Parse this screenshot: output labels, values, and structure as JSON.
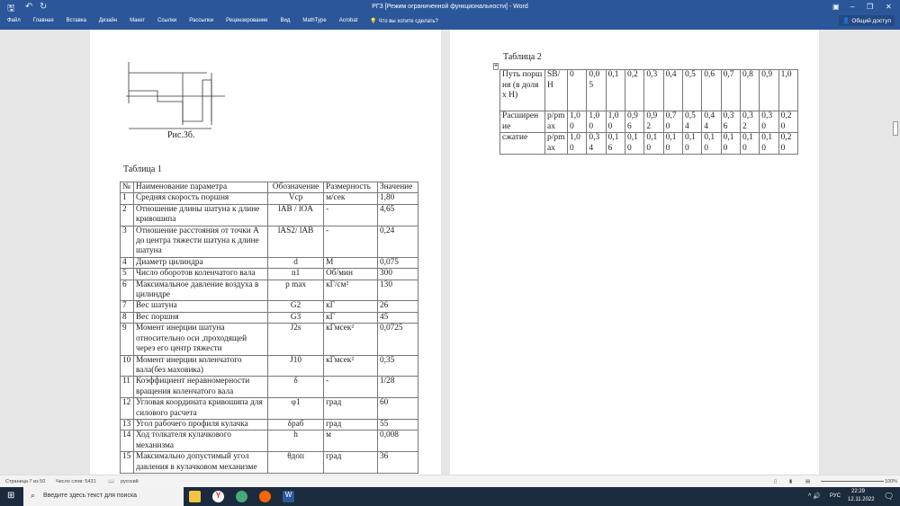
{
  "window": {
    "title": "РГЗ [Режим ограниченной функциональности] - Word",
    "share": "Общий доступ"
  },
  "ribbon": {
    "tabs": [
      "Файл",
      "Главная",
      "Вставка",
      "Дизайн",
      "Макет",
      "Ссылки",
      "Рассылки",
      "Рецензирование",
      "Вид",
      "MathType",
      "Acrobat"
    ],
    "tell_me": "Что вы хотите сделать?"
  },
  "figure": {
    "caption": "Рис.3б."
  },
  "table1": {
    "caption": "Таблица 1",
    "headers": [
      "№",
      "Наименование параметра",
      "Обозначение",
      "Размерность",
      "Значение"
    ],
    "rows": [
      [
        "1",
        "Средняя скорость поршня",
        "Vср",
        "м/сек",
        "1,80"
      ],
      [
        "2",
        "Отношение длины шатуна к длине кривошипа",
        "lAB / lOA",
        "-",
        "4,65"
      ],
      [
        "3",
        "Отношение расстояния от точки А до центра тяжести шатуна к длине шатуна",
        "lAS2/ lAB",
        "-",
        "0,24"
      ],
      [
        "4",
        "Диаметр цилиндра",
        "d",
        "М",
        "0,075"
      ],
      [
        "5",
        "Число оборотов коленчатого вала",
        "n1",
        "Об/мин",
        "300"
      ],
      [
        "6",
        "Максимальное давление воздуха в цилиндре",
        "p max",
        "кГ/см²",
        "130"
      ],
      [
        "7",
        "Вес шатуна",
        "G2",
        "кГ",
        "26"
      ],
      [
        "8",
        "Вес поршня",
        "G3",
        "кГ",
        "45"
      ],
      [
        "9",
        "Момент инерции шатуна относительно оси ,проходящей через его центр тяжести",
        "J2s",
        "кГмсек²",
        "0,0725"
      ],
      [
        "10",
        "Момент инерции коленчатого вала(без маховика)",
        "J10",
        "кГмсек²",
        "0,35"
      ],
      [
        "11",
        "Коэффициент неравномерности вращения коленчатого вала",
        "δ",
        "-",
        "1/28"
      ],
      [
        "12",
        "Угловая координата кривошипа для силового расчета",
        "φ1",
        "град",
        "60"
      ],
      [
        "13",
        "Угол рабочего профиля кулачка",
        "δраб",
        "град",
        "55"
      ],
      [
        "14",
        "Ход толкателя кулачкового механизма",
        "h",
        "м",
        "0,008"
      ],
      [
        "15",
        "Максимально допустимый угол давления в кулачковом механизме",
        "θдоп",
        "град",
        "36"
      ]
    ]
  },
  "table2": {
    "caption": "Таблица 2",
    "rows": [
      [
        "Путь поршня (в долях Н)",
        "SB/Н",
        "0",
        "0,05",
        "0,1",
        "0,2",
        "0,3",
        "0,4",
        "0,5",
        "0,6",
        "0,7",
        "0,8",
        "0,9",
        "1,0"
      ],
      [
        "Расширение",
        "p/pmax",
        "1,00",
        "1,00",
        "1,00",
        "0,96",
        "0,92",
        "0,70",
        "0,54",
        "0,44",
        "0,36",
        "0,32",
        "0,30",
        "0,20"
      ],
      [
        "сжатие",
        "p/pmax",
        "1,00",
        "0,34",
        "0,16",
        "0,10",
        "0,10",
        "0,10",
        "0,10",
        "0,10",
        "0,10",
        "0,10",
        "0,10",
        "0,20"
      ]
    ]
  },
  "status": {
    "page": "Страница 7 из 50",
    "words": "Число слов: 5431",
    "lang": "русский",
    "zoom": "100%"
  },
  "taskbar": {
    "search": "Введите здесь текст для поиска",
    "lang": "РУС",
    "time": "22:29",
    "date": "12.11.2022"
  }
}
